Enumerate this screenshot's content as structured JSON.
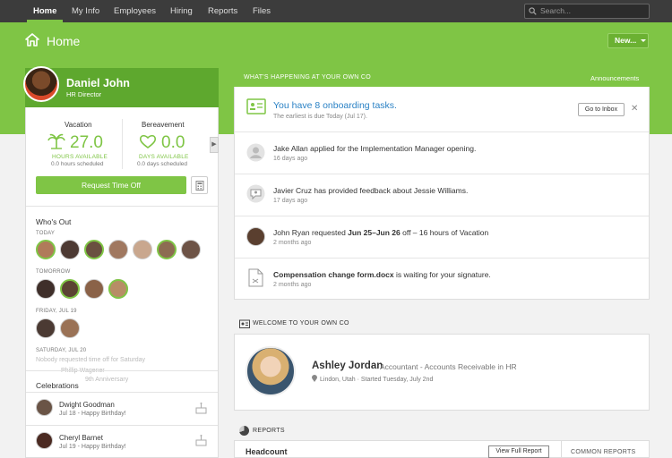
{
  "nav": {
    "tabs": [
      "Home",
      "My Info",
      "Employees",
      "Hiring",
      "Reports",
      "Files"
    ],
    "search_placeholder": "Search..."
  },
  "header": {
    "title": "Home",
    "new_button": "New..."
  },
  "colors": {
    "brand_green": "#7fc545",
    "link_blue": "#2b82c5",
    "nav_bg": "#3c3c3c"
  },
  "profile": {
    "name": "Daniel John",
    "role": "HR Director"
  },
  "balances": [
    {
      "label": "Vacation",
      "value": "27.0",
      "unit": "HOURS AVAILABLE",
      "scheduled": "0.0 hours scheduled",
      "icon": "palm-tree-icon"
    },
    {
      "label": "Bereavement",
      "value": "0.0",
      "unit": "DAYS AVAILABLE",
      "scheduled": "0.0 days scheduled",
      "icon": "heart-hand-icon"
    }
  ],
  "request_button": "Request Time Off",
  "whos_out": {
    "title": "Who's Out",
    "days": [
      "TODAY",
      "TOMORROW",
      "FRIDAY, JUL 19",
      "SATURDAY, JUL 20"
    ],
    "saturday_note": "Nobody requested time off for Saturday",
    "faded_name": "Phillip Wagener",
    "faded_sub": "9th Anniversary"
  },
  "celebrations": {
    "title": "Celebrations",
    "items": [
      {
        "name": "Dwight Goodman",
        "detail": "Jul 18 - Happy Birthday!"
      },
      {
        "name": "Cheryl Barnet",
        "detail": "Jul 19 - Happy Birthday!"
      }
    ]
  },
  "feed": {
    "title": "WHAT'S HAPPENING AT YOUR OWN CO",
    "announcements": "Announcements",
    "onboarding_title": "You have 8 onboarding tasks.",
    "onboarding_sub": "The earliest is due Today (Jul 17).",
    "inbox_button": "Go to Inbox",
    "items": [
      {
        "text": "Jake Allan applied for the Implementation Manager opening.",
        "time": "16 days ago"
      },
      {
        "text": "Javier Cruz has provided feedback about Jessie Williams.",
        "time": "17 days ago"
      },
      {
        "pre": "John Ryan requested ",
        "bold": "Jun 25–Jun 26",
        "post": " off – 16 hours of Vacation",
        "time": "2 months ago"
      },
      {
        "bold": "Compensation change form.docx",
        "post": " is waiting for your signature.",
        "time": "2 months ago"
      }
    ]
  },
  "welcome": {
    "title": "WELCOME TO YOUR OWN CO",
    "name": "Ashley Jordan",
    "job": "Accountant - Accounts Receivable in HR",
    "location": "Lindon, Utah · Started Tuesday, July 2nd"
  },
  "reports": {
    "title": "REPORTS",
    "headcount": "Headcount",
    "full_report": "View Full Report",
    "common": "COMMON REPORTS"
  }
}
